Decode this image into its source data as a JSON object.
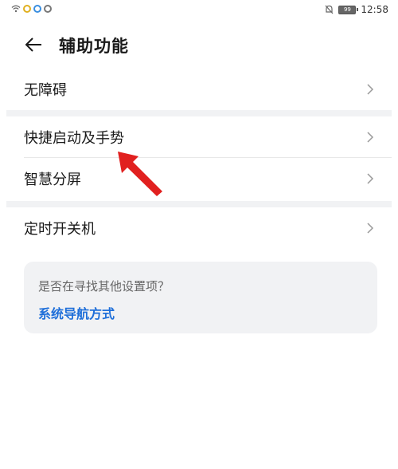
{
  "status_bar": {
    "time": "12:58",
    "battery": "99"
  },
  "header": {
    "title": "辅助功能"
  },
  "groups": [
    {
      "items": [
        {
          "label": "无障碍"
        }
      ]
    },
    {
      "items": [
        {
          "label": "快捷启动及手势"
        },
        {
          "label": "智慧分屏"
        }
      ]
    },
    {
      "items": [
        {
          "label": "定时开关机"
        }
      ]
    }
  ],
  "suggestion": {
    "question": "是否在寻找其他设置项？",
    "link": "系统导航方式"
  },
  "colors": {
    "link": "#1f6fd9",
    "arrow": "#e1201f",
    "section_gap": "#f1f2f4"
  }
}
